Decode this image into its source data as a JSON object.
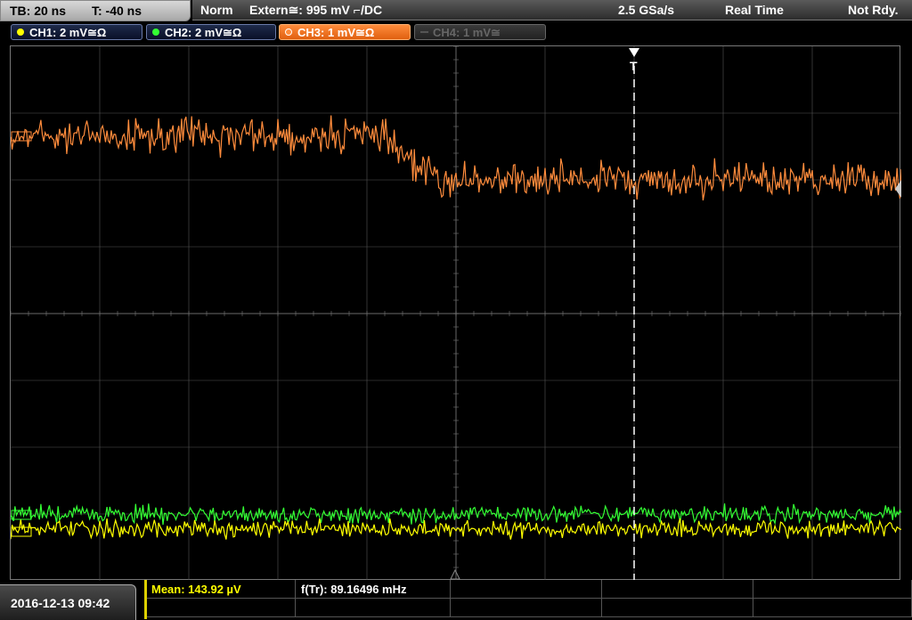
{
  "header": {
    "timebase": "TB: 20 ns",
    "trigger_time": "T: -40 ns",
    "trigger_mode": "Norm",
    "trigger_source": "Extern≅: 995 mV ⌐/DC",
    "sample_rate": "2.5 GSa/s",
    "acq_mode": "Real Time",
    "status": "Not Rdy."
  },
  "channels": [
    {
      "label": "CH1: 2 mV≅Ω",
      "color": "#ffff00"
    },
    {
      "label": "CH2: 2 mV≅Ω",
      "color": "#33ff33"
    },
    {
      "label": "CH3: 1 mV≅Ω",
      "color": "#ff8c3c"
    },
    {
      "label": "CH4: 1 mV≅",
      "color": "#666666"
    }
  ],
  "trigger_marker": "T",
  "measurements": {
    "mean": "Mean: 143.92 µV",
    "freq": "f(Tr): 89.16496 mHz"
  },
  "datetime": "2016-12-13 09:42",
  "colors": {
    "ch1": "#ffff00",
    "ch2": "#33ff33",
    "ch3": "#ff8c3c",
    "grid": "#555555"
  }
}
